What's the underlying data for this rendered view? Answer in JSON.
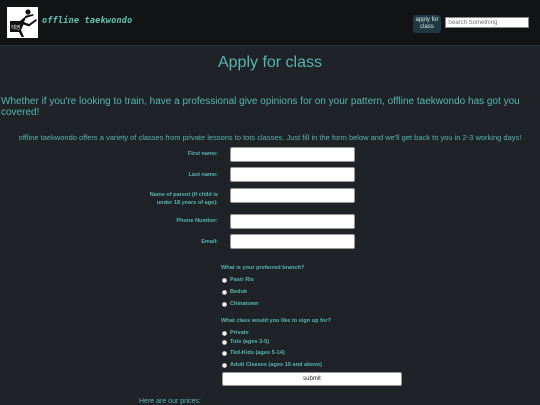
{
  "header": {
    "brand": "offline taekwondo",
    "apply_button": "apply for class",
    "search_placeholder": "Search Something",
    "logo_icon": "taekwondo-kick-icon"
  },
  "main": {
    "title": "Apply for class",
    "lead": "Whether if you're looking to train, have a professional give opinions for on your pattern, offline taekwondo has got you covered!",
    "intro": "offline taekwondo offers a variety of classes from private lessons to tots classes. Just fill in the form below and we'll get back to you in 2-3 working days!",
    "form": {
      "first_name": "First name:",
      "last_name": "Last name:",
      "parent_name": "Name of parent (if child is under 18 years of age):",
      "phone": "Phone Number:",
      "email": "Email:",
      "branch_question": "What is your preferred branch?",
      "branches": [
        "Pasir Ris",
        "Bedok",
        "Chinatown"
      ],
      "class_question": "What class would you like to sign up for?",
      "classes": [
        "Private",
        "Tots (ages 3-5)",
        "Tkd-Kids (ages 5-14)",
        "Adult Classes (ages 15 and above)"
      ],
      "submit": "submit"
    },
    "prices_heading": "Here are our prices:"
  },
  "colors": {
    "accent": "#56b6b1",
    "background": "#1f2327",
    "topbar": "#111315"
  }
}
